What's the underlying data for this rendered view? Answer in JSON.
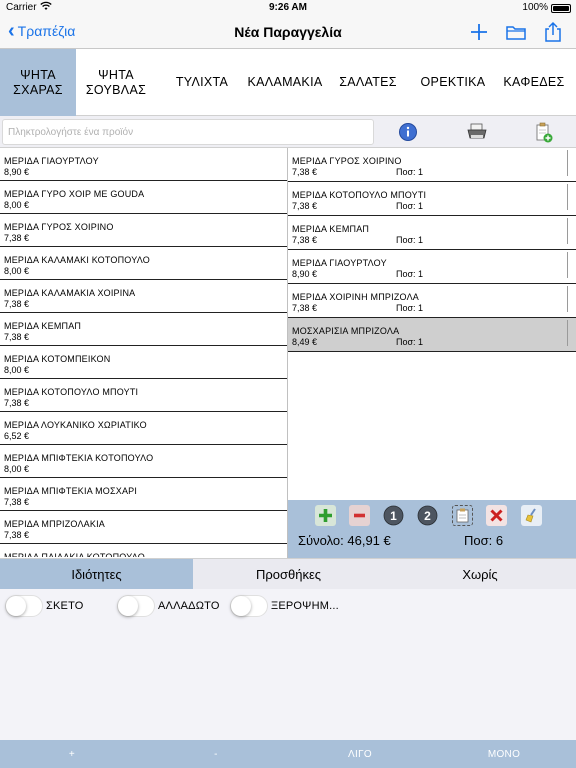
{
  "status_bar": {
    "carrier": "Carrier",
    "time": "9:26 AM",
    "battery": "100%"
  },
  "nav": {
    "back_label": "Τραπέζια",
    "title": "Νέα Παραγγελία",
    "icons": [
      "plus-icon",
      "folder-icon",
      "share-icon"
    ],
    "accent_color": "#1a73e8"
  },
  "categories": [
    {
      "line1": "ΨΗΤΑ",
      "line2": "ΣΧΑΡΑΣ",
      "active": true
    },
    {
      "line1": "ΨΗΤΑ",
      "line2": "ΣΟΥΒΛΑΣ",
      "active": false
    },
    {
      "line1": "ΤΥΛΙΧΤΑ",
      "line2": "",
      "active": false
    },
    {
      "line1": "ΚΑΛΑΜΑΚΙΑ",
      "line2": "",
      "active": false
    },
    {
      "line1": "ΣΑΛΑΤΕΣ",
      "line2": "",
      "active": false
    },
    {
      "line1": "ΟΡΕΚΤΙΚΑ",
      "line2": "",
      "active": false
    },
    {
      "line1": "ΚΑΦΕΔΕΣ",
      "line2": "",
      "active": false
    }
  ],
  "search": {
    "placeholder": "Πληκτρολογήστε ένα προϊόν",
    "value": ""
  },
  "toolbar_icons": [
    "info-icon",
    "printer-icon",
    "add-document-icon"
  ],
  "products": [
    {
      "name": "ΜΕΡΙΔΑ ΓΙΑΟΥΡΤΛΟΥ",
      "price": "8,90 €"
    },
    {
      "name": "ΜΕΡΙΔΑ ΓΥΡΟ ΧΟΙΡ ΜΕ GOUDA",
      "price": "8,00 €"
    },
    {
      "name": "ΜΕΡΙΔΑ ΓΥΡΟΣ ΧΟΙΡΙΝΟ",
      "price": "7,38 €"
    },
    {
      "name": "ΜΕΡΙΔΑ ΚΑΛΑΜΑΚΙ ΚΟΤΟΠΟΥΛΟ",
      "price": "8,00 €"
    },
    {
      "name": "ΜΕΡΙΔΑ ΚΑΛΑΜΑΚΙΑ ΧΟΙΡΙΝΑ",
      "price": "7,38 €"
    },
    {
      "name": "ΜΕΡΙΔΑ ΚΕΜΠΑΠ",
      "price": "7,38 €"
    },
    {
      "name": "ΜΕΡΙΔΑ ΚΟΤΟΜΠΕΙΚΟΝ",
      "price": "8,00 €"
    },
    {
      "name": "ΜΕΡΙΔΑ ΚΟΤΟΠΟΥΛΟ ΜΠΟΥΤΙ",
      "price": "7,38 €"
    },
    {
      "name": "ΜΕΡΙΔΑ ΛΟΥΚΑΝΙΚΟ ΧΩΡΙΑΤΙΚΟ",
      "price": "6,52 €"
    },
    {
      "name": "ΜΕΡΙΔΑ ΜΠΙΦΤΕΚΙΑ ΚΟΤΟΠΟΥΛΟ",
      "price": "8,00 €"
    },
    {
      "name": "ΜΕΡΙΔΑ ΜΠΙΦΤΕΚΙΑ ΜΟΣΧΑΡΙ",
      "price": "7,38 €"
    },
    {
      "name": "ΜΕΡΙΔΑ ΜΠΡΙΖΟΛΑΚΙΑ",
      "price": "7,38 €"
    },
    {
      "name": "ΜΕΡΙΔΑ ΠΑΙΔΑΚΙΑ ΚΟΤΟΠΟΥΛΟ",
      "price": ""
    }
  ],
  "order": {
    "qty_prefix": "Ποσ:",
    "items": [
      {
        "name": "ΜΕΡΙΔΑ ΓΥΡΟΣ ΧΟΙΡΙΝΟ",
        "price": "7,38 €",
        "qty": "Ποσ: 1",
        "selected": false
      },
      {
        "name": "ΜΕΡΙΔΑ ΚΟΤΟΠΟΥΛΟ ΜΠΟΥΤΙ",
        "price": "7,38 €",
        "qty": "Ποσ: 1",
        "selected": false
      },
      {
        "name": "ΜΕΡΙΔΑ ΚΕΜΠΑΠ",
        "price": "7,38 €",
        "qty": "Ποσ: 1",
        "selected": false
      },
      {
        "name": "ΜΕΡΙΔΑ ΓΙΑΟΥΡΤΛΟΥ",
        "price": "8,90 €",
        "qty": "Ποσ: 1",
        "selected": false
      },
      {
        "name": "ΜΕΡΙΔΑ ΧΟΙΡΙΝΗ ΜΠΡΙΖΟΛΑ",
        "price": "7,38 €",
        "qty": "Ποσ: 1",
        "selected": false
      },
      {
        "name": "ΜΟΣΧΑΡΙΣΙΑ ΜΠΡΙΖΟΛΑ",
        "price": "8,49 €",
        "qty": "Ποσ: 1",
        "selected": true
      }
    ],
    "actions": [
      "add-icon",
      "remove-icon",
      "one-icon",
      "two-icon",
      "note-icon",
      "delete-icon",
      "clear-icon"
    ],
    "total": "Σύνολο: 46,91 €",
    "total_qty": "Ποσ: 6"
  },
  "detail_tabs": [
    {
      "label": "Ιδιότητες",
      "active": true
    },
    {
      "label": "Προσθήκες",
      "active": false
    },
    {
      "label": "Χωρίς",
      "active": false
    }
  ],
  "options": [
    {
      "label": "ΣΚΕΤΟ",
      "on": false
    },
    {
      "label": "ΑΛΛΑΔΩΤΟ",
      "on": false
    },
    {
      "label": "ΞΕΡΟΨΗΜ..."
    }
  ],
  "bottom_bar": [
    {
      "label": "+"
    },
    {
      "label": "-"
    },
    {
      "label": "ΛΙΓΟ"
    },
    {
      "label": "ΜΟΝΟ"
    }
  ],
  "colors": {
    "panel_blue": "#a9c0d9",
    "selected_row": "#cfcfcf",
    "accent": "#1a73e8"
  }
}
